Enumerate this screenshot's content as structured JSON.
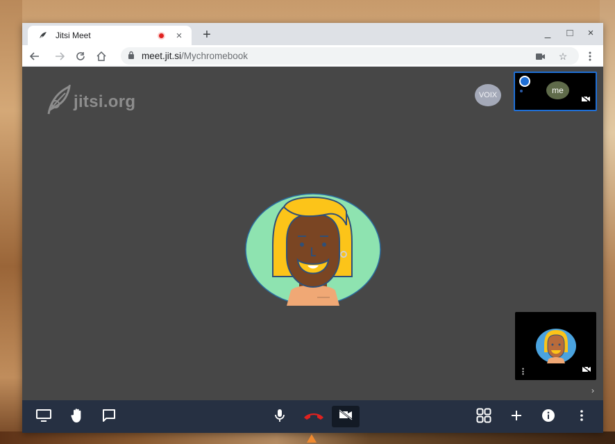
{
  "browser": {
    "tab_title": "Jitsi Meet",
    "tab_close": "×",
    "new_tab": "+",
    "url_host": "meet.jit.si",
    "url_path": "/Mychromebook",
    "window_controls": {
      "minimize": "_",
      "maximize": "□",
      "close": "×"
    }
  },
  "meeting": {
    "watermark": "jitsi.org",
    "dominant_speaker_badge": "VOIX",
    "local_thumbnail_label": "me",
    "main_avatar": "cartoon-avatar-blonde-beard",
    "thumbnail_avatar": "cartoon-avatar-blonde-beard",
    "filmstrip_toggle": "›"
  },
  "toolbar_icons": {
    "left": [
      "screen-share-icon",
      "raise-hand-icon",
      "chat-icon"
    ],
    "center": [
      "microphone-icon",
      "hangup-icon",
      "camera-off-icon"
    ],
    "right": [
      "tile-view-icon",
      "invite-icon",
      "info-icon",
      "more-icon"
    ]
  },
  "colors": {
    "stage": "#474747",
    "toolbar": "#263042",
    "hangup": "#e0211f",
    "avatar_bg": "#8ee3b0",
    "accent_blue": "#1f6fd6"
  }
}
